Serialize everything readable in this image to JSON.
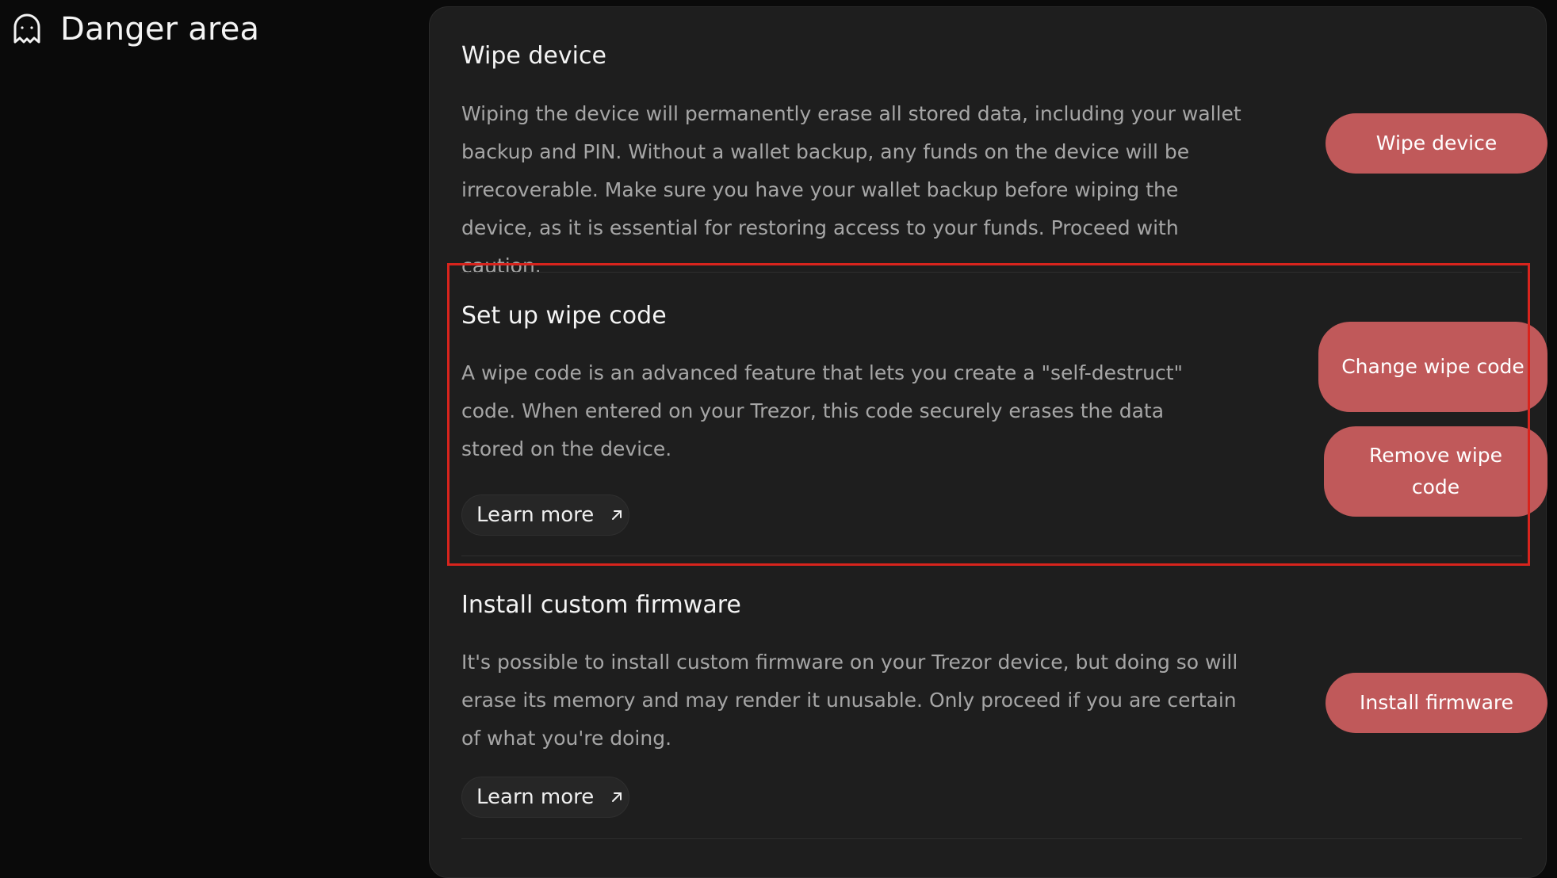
{
  "section": {
    "title": "Danger area",
    "icon": "ghost-icon"
  },
  "colors": {
    "danger_button": "#c0595a",
    "highlight": "#d8241d",
    "card_bg": "#1e1e1e",
    "page_bg": "#0a0a0a"
  },
  "wipe_device": {
    "title": "Wipe device",
    "description": "Wiping the device will permanently erase all stored data, including your wallet backup and PIN. Without a wallet backup, any funds on the device will be irrecoverable. Make sure you have your wallet backup before wiping the device, as it is essential for restoring access to your funds. Proceed with caution.",
    "button_label": "Wipe device"
  },
  "wipe_code": {
    "title": "Set up wipe code",
    "description": "A wipe code is an advanced feature that lets you create a \"self-destruct\" code. When entered on your Trezor, this code securely erases the data stored on the device.",
    "learn_more_label": "Learn more",
    "change_button_label": "Change wipe code",
    "remove_button_label": "Remove wipe code"
  },
  "custom_firmware": {
    "title": "Install custom firmware",
    "description": "It's possible to install custom firmware on your Trezor device, but doing so will erase its memory and may render it unusable. Only proceed if you are certain of what you're doing.",
    "learn_more_label": "Learn more",
    "button_label": "Install firmware"
  }
}
